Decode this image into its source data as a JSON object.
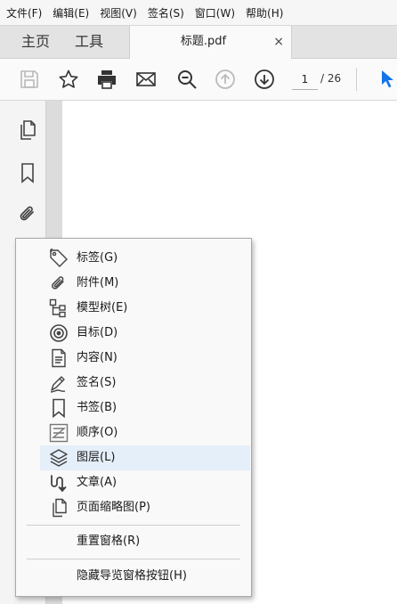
{
  "menubar": {
    "items": [
      "文件(F)",
      "编辑(E)",
      "视图(V)",
      "签名(S)",
      "窗口(W)",
      "帮助(H)"
    ]
  },
  "tabs": {
    "home": "主页",
    "tools": "工具",
    "document_title": "标题.pdf",
    "close_glyph": "×"
  },
  "toolbar": {
    "icons": [
      "save-icon",
      "star-icon",
      "print-icon",
      "email-icon",
      "zoom-out-icon",
      "page-up-icon",
      "page-down-icon",
      "select-pointer-icon"
    ],
    "page_current": "1",
    "page_total": "/ 26",
    "accent_color": "#1473e6"
  },
  "left_panel": {
    "icons": [
      "page-thumbnails-icon",
      "bookmark-icon",
      "attachment-icon"
    ]
  },
  "context_menu": {
    "items": [
      {
        "label": "标签(G)",
        "icon": "tag-icon"
      },
      {
        "label": "附件(M)",
        "icon": "paperclip-icon"
      },
      {
        "label": "模型树(E)",
        "icon": "model-tree-icon"
      },
      {
        "label": "目标(D)",
        "icon": "target-icon"
      },
      {
        "label": "内容(N)",
        "icon": "content-icon"
      },
      {
        "label": "签名(S)",
        "icon": "signature-icon"
      },
      {
        "label": "书签(B)",
        "icon": "bookmark-icon"
      },
      {
        "label": "顺序(O)",
        "icon": "order-icon"
      },
      {
        "label": "图层(L)",
        "icon": "layers-icon",
        "highlighted": true
      },
      {
        "label": "文章(A)",
        "icon": "article-icon"
      },
      {
        "label": "页面缩略图(P)",
        "icon": "page-thumbnails-icon"
      }
    ],
    "reset_panes": "重置窗格(R)",
    "hide_nav_buttons": "隐藏导览窗格按钮(H)",
    "highlight_color": "#e5eff9"
  }
}
